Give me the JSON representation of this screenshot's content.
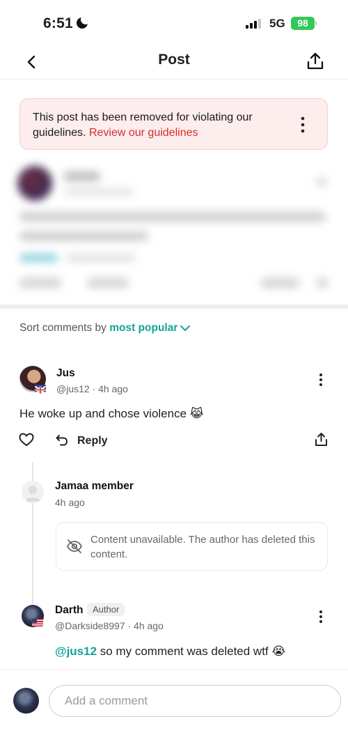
{
  "status_bar": {
    "time": "6:51",
    "network": "5G",
    "battery": "98"
  },
  "header": {
    "title": "Post"
  },
  "removed_banner": {
    "text": "This post has been removed for violating our guidelines.",
    "link": "Review our guidelines"
  },
  "sort": {
    "label": "Sort comments by",
    "value": "most popular"
  },
  "comments": [
    {
      "name": "Jus",
      "meta": "@jus12 · 4h ago",
      "body": "He woke up and chose violence 😹",
      "reply_label": "Reply"
    },
    {
      "name": "Jamaa member",
      "meta": "4h ago",
      "unavailable": "Content unavailable. The author has deleted this content."
    },
    {
      "name": "Darth",
      "badge": "Author",
      "meta": "@Darkside8997 · 4h ago",
      "mention": "@jus12",
      "body": " so my comment was deleted wtf 😭"
    }
  ],
  "composer": {
    "placeholder": "Add a comment"
  },
  "colors": {
    "accent": "#14a39a",
    "danger": "#d42d2d",
    "banner_bg": "#fdeded"
  }
}
